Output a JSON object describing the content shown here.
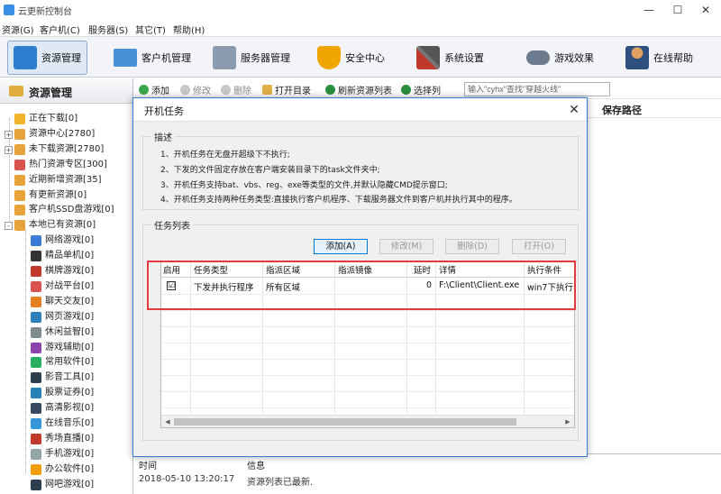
{
  "window": {
    "title": "云更新控制台",
    "controls": [
      "—",
      "☐",
      "✕"
    ]
  },
  "menu": [
    "资源(G)",
    "客户机(C)",
    "服务器(S)",
    "其它(T)",
    "帮助(H)"
  ],
  "toolbar": [
    {
      "label": "资源管理",
      "icon": "resource-icon"
    },
    {
      "label": "客户机管理",
      "icon": "monitor-icon"
    },
    {
      "label": "服务器管理",
      "icon": "server-icon"
    },
    {
      "label": "安全中心",
      "icon": "shield-icon"
    },
    {
      "label": "系统设置",
      "icon": "tools-icon"
    },
    {
      "label": "游戏效果",
      "icon": "gamepad-icon"
    },
    {
      "label": "在线帮助",
      "icon": "person-icon"
    }
  ],
  "sidebar": {
    "title": "资源管理",
    "items": [
      {
        "label": "正在下载[0]"
      },
      {
        "label": "资源中心[2780]"
      },
      {
        "label": "未下载资源[2780]"
      },
      {
        "label": "热门资源专区[300]"
      },
      {
        "label": "近期新增资源[35]"
      },
      {
        "label": "有更新资源[0]"
      },
      {
        "label": "客户机SSD盘游戏[0]"
      },
      {
        "label": "本地已有资源[0]"
      },
      {
        "label": "网络游戏[0]"
      },
      {
        "label": "精品单机[0]"
      },
      {
        "label": "棋牌游戏[0]"
      },
      {
        "label": "对战平台[0]"
      },
      {
        "label": "聊天交友[0]"
      },
      {
        "label": "网页游戏[0]"
      },
      {
        "label": "休闲益智[0]"
      },
      {
        "label": "游戏辅助[0]"
      },
      {
        "label": "常用软件[0]"
      },
      {
        "label": "影音工具[0]"
      },
      {
        "label": "股票证券[0]"
      },
      {
        "label": "高清影视[0]"
      },
      {
        "label": "在线音乐[0]"
      },
      {
        "label": "秀场直播[0]"
      },
      {
        "label": "手机游戏[0]"
      },
      {
        "label": "办公软件[0]"
      },
      {
        "label": "网吧游戏[0]"
      }
    ]
  },
  "resource_toolbar": {
    "add": "添加",
    "modify": "修改",
    "delete": "删除",
    "open_dir": "打开目录",
    "refresh": "刷新资源列表",
    "select_col": "选择列",
    "search_placeholder": "输入\"cyhx\"查找\"穿越火线\""
  },
  "main_list": {
    "col_save_path": "保存路径"
  },
  "log": {
    "col_time": "时间",
    "col_info": "信息",
    "time": "2018-05-10 13:20:17",
    "info": "资源列表已最新."
  },
  "dialog": {
    "title": "开机任务",
    "close": "✕",
    "desc_title": "描述",
    "desc_lines": [
      "1、开机任务在无盘开超级下不执行;",
      "2、下发的文件固定存放在客户端安装目录下的task文件夹中;",
      "3、开机任务支持bat、vbs、reg、exe等类型的文件,并默认隐藏CMD提示窗口;",
      "4、开机任务支持两种任务类型:直接执行客户机程序、下载服务器文件到客户机并执行其中的程序。"
    ],
    "task_list_title": "任务列表",
    "buttons": {
      "add": "添加(A)",
      "modify": "修改(M)",
      "delete": "删除(D)",
      "open": "打开(O)"
    },
    "columns": [
      "启用",
      "任务类型",
      "指派区域",
      "指派镜像",
      "延时",
      "详情",
      "执行条件"
    ],
    "rows": [
      {
        "enabled": "☑",
        "type": "下发并执行程序",
        "area": "所有区域",
        "image": "",
        "delay": "0",
        "detail": "F:\\Client\\Client.exe",
        "condition": "win7下执行"
      }
    ]
  },
  "colors": {
    "accent": "#3a7bd5",
    "highlight": "#e33b3b"
  }
}
